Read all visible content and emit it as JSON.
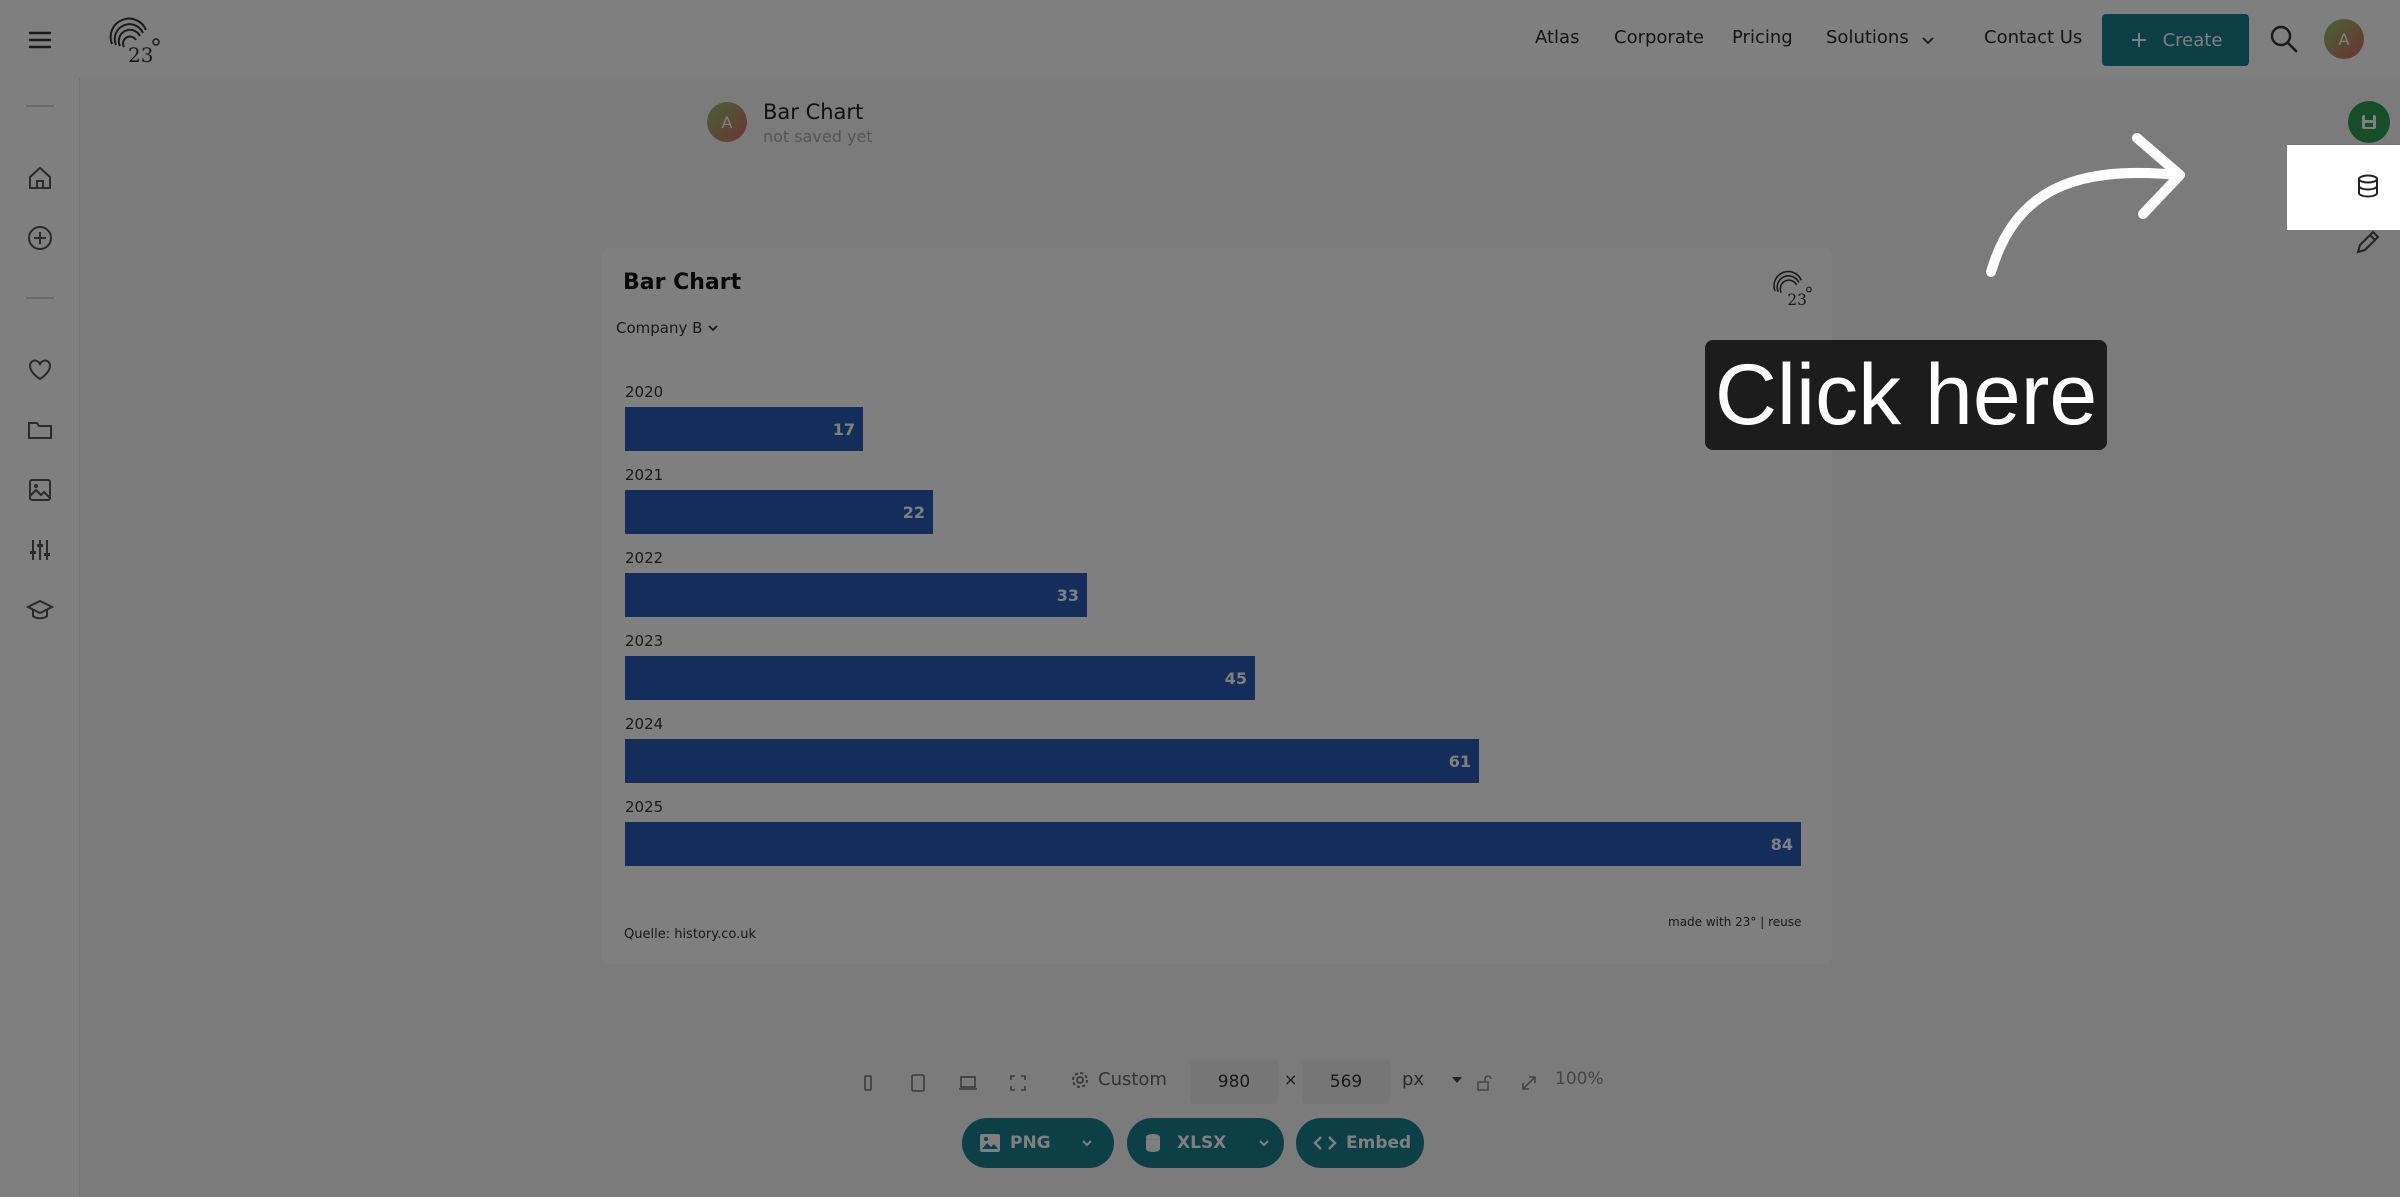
{
  "header": {
    "nav": [
      "Atlas",
      "Corporate",
      "Pricing",
      "Solutions",
      "Contact Us"
    ],
    "create_label": "Create",
    "avatar_initial": "A"
  },
  "document": {
    "avatar_initial": "A",
    "title": "Bar Chart",
    "status": "not saved yet"
  },
  "chart_data": {
    "type": "bar",
    "orientation": "horizontal",
    "title": "Bar Chart",
    "series_selector": "Company B",
    "categories": [
      "2020",
      "2021",
      "2022",
      "2023",
      "2024",
      "2025"
    ],
    "values": [
      17,
      22,
      33,
      45,
      61,
      84
    ],
    "value_labels": [
      "17",
      "22",
      "33",
      "45",
      "61",
      "84"
    ],
    "xlim": [
      0,
      84
    ],
    "bar_color": "#2a5bb6",
    "grid": false,
    "source": "Quelle: history.co.uk",
    "credit": "made with 23° | reuse"
  },
  "toolbar": {
    "size_preset": "Custom",
    "width": "980",
    "height": "569",
    "times": "×",
    "unit": "px",
    "zoom": "100%",
    "exports": [
      "PNG",
      "XLSX",
      "Embed"
    ]
  },
  "overlay": {
    "tooltip": "Click here"
  },
  "colors": {
    "accent": "#1b7f8c",
    "save": "#2e9c52"
  }
}
